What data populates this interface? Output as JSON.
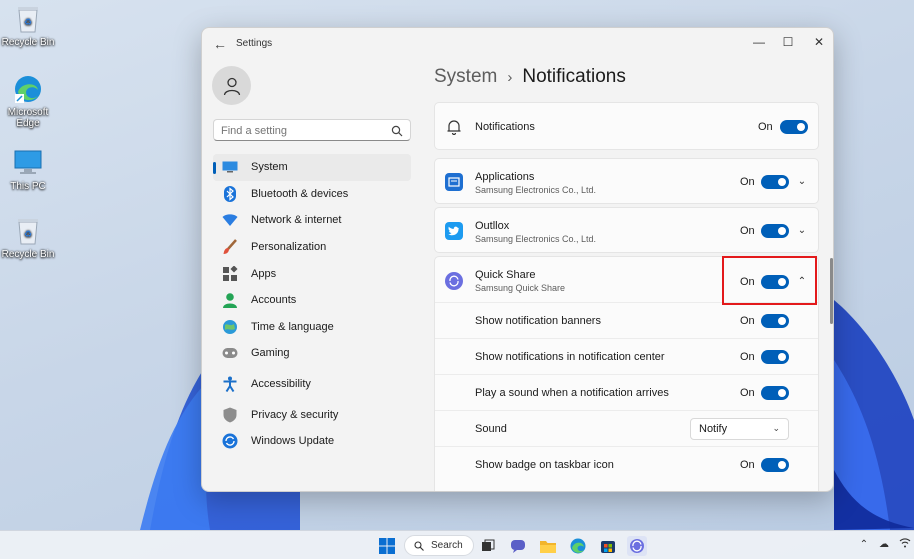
{
  "desktop": {
    "icons": [
      {
        "label": "Recycle Bin",
        "icon": "recycle-bin-icon"
      },
      {
        "label": "Microsoft Edge",
        "icon": "edge-icon"
      },
      {
        "label": "This PC",
        "icon": "monitor-icon"
      },
      {
        "label": "Recycle Bin",
        "icon": "recycle-bin-icon"
      }
    ]
  },
  "window": {
    "app_title": "Settings",
    "search_placeholder": "Find a setting"
  },
  "nav": {
    "items": [
      {
        "label": "System",
        "icon": "monitor-icon",
        "active": true
      },
      {
        "label": "Bluetooth & devices",
        "icon": "bluetooth-icon"
      },
      {
        "label": "Network & internet",
        "icon": "wifi-icon"
      },
      {
        "label": "Personalization",
        "icon": "brush-icon"
      },
      {
        "label": "Apps",
        "icon": "apps-icon"
      },
      {
        "label": "Accounts",
        "icon": "person-icon"
      },
      {
        "label": "Time & language",
        "icon": "globe-clock-icon"
      },
      {
        "label": "Gaming",
        "icon": "controller-icon"
      },
      {
        "label": "Accessibility",
        "icon": "accessibility-icon"
      },
      {
        "label": "Privacy & security",
        "icon": "shield-icon"
      },
      {
        "label": "Windows Update",
        "icon": "update-icon"
      }
    ]
  },
  "breadcrumb": {
    "parent": "System",
    "separator": "›",
    "current": "Notifications"
  },
  "notifications": {
    "title": "Notifications",
    "state": "On"
  },
  "apps": [
    {
      "name": "Applications",
      "publisher": "Samsung Electronics Co., Ltd.",
      "state": "On",
      "icon": "applications-icon",
      "color": "#1e6fd1"
    },
    {
      "name": "Outllox",
      "publisher": "Samsung Electronics Co., Ltd.",
      "state": "On",
      "icon": "twitter-bird-icon",
      "color": "#1d9bf0"
    },
    {
      "name": "Quick Share",
      "publisher": "Samsung Quick Share",
      "state": "On",
      "icon": "quick-share-icon",
      "color": "#6b6fe0"
    }
  ],
  "quick_share_options": {
    "banners": {
      "label": "Show notification banners",
      "state": "On"
    },
    "center": {
      "label": "Show notifications in notification center",
      "state": "On"
    },
    "sound_on_arrive": {
      "label": "Play a sound when a notification arrives",
      "state": "On"
    },
    "sound": {
      "label": "Sound",
      "value": "Notify"
    },
    "badge": {
      "label": "Show badge on taskbar icon",
      "state": "On"
    }
  },
  "taskbar": {
    "search_label": "Search"
  },
  "colors": {
    "accent": "#005fb8",
    "highlight": "#e3191b"
  }
}
